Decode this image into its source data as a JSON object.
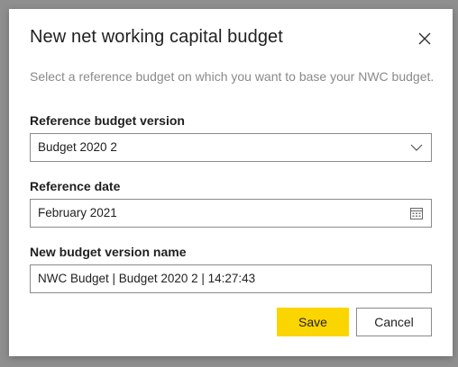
{
  "dialog": {
    "title": "New net working capital budget",
    "subtitle": "Select a reference budget on which you want to base your NWC budget.",
    "close_icon": "close-icon"
  },
  "reference_budget": {
    "label": "Reference budget version",
    "value": "Budget 2020 2",
    "icon": "chevron-down-icon"
  },
  "reference_date": {
    "label": "Reference date",
    "value": "February 2021",
    "icon": "calendar-icon"
  },
  "new_version_name": {
    "label": "New budget version name",
    "value": "NWC Budget | Budget 2020 2 | 14:27:43"
  },
  "actions": {
    "save_label": "Save",
    "cancel_label": "Cancel"
  },
  "colors": {
    "accent": "#fbd500",
    "border": "#8a8a8a",
    "overlay": "#8f8f8f"
  }
}
